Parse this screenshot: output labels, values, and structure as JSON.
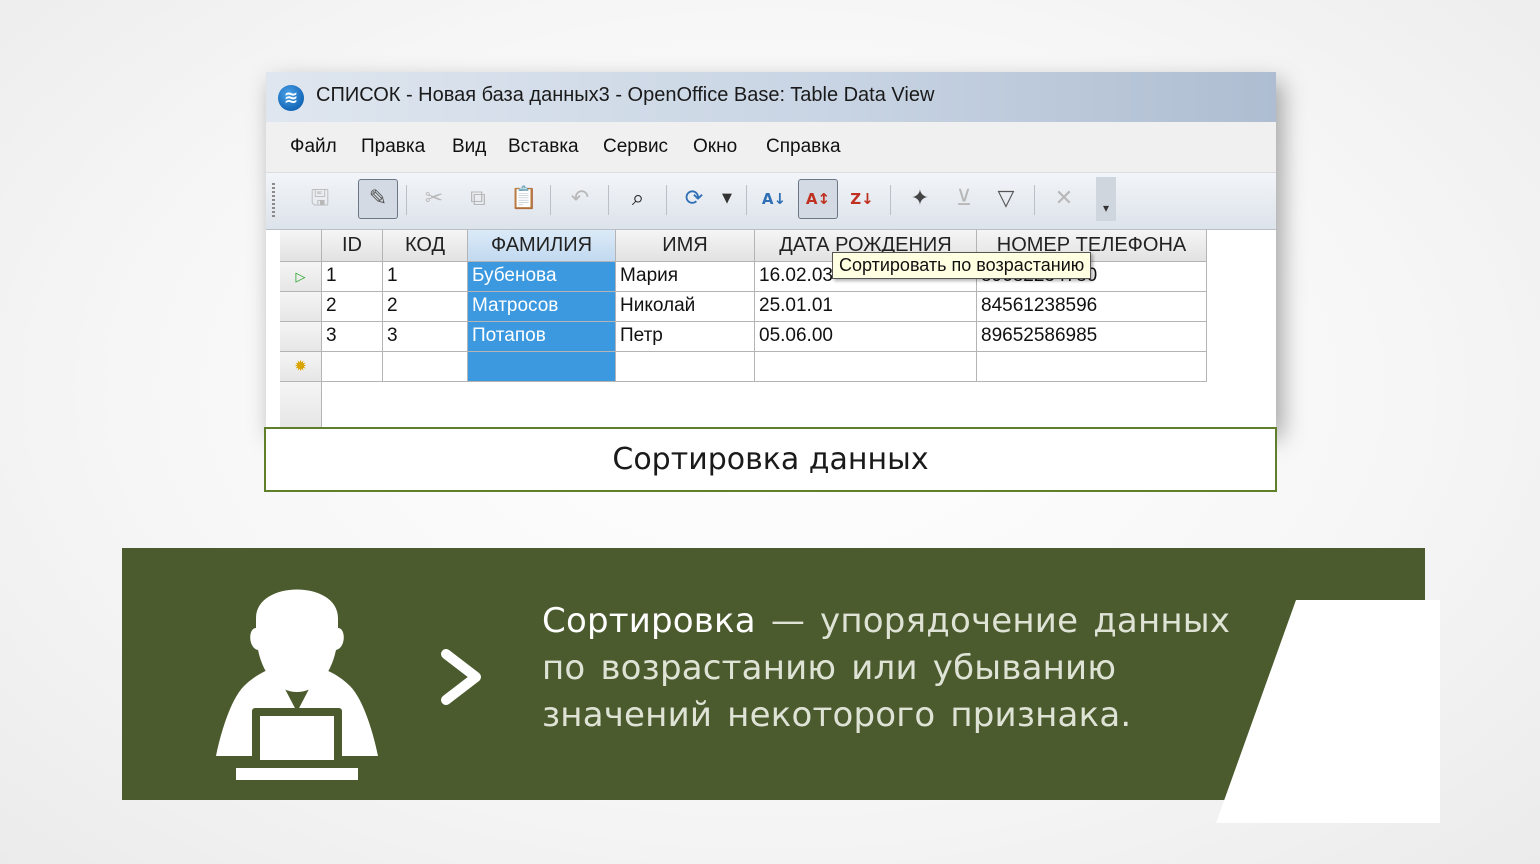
{
  "window": {
    "title": "СПИСОК - Новая база данных3 - OpenOffice Base: Table Data View",
    "logo_icon": "openoffice-logo-icon"
  },
  "menu": [
    "Файл",
    "Правка",
    "Вид",
    "Вставка",
    "Сервис",
    "Окно",
    "Справка"
  ],
  "toolbar": {
    "icons": [
      "save-icon",
      "edit-icon",
      "cut-icon",
      "copy-icon",
      "paste-icon",
      "undo-icon",
      "find-icon",
      "refresh-icon",
      "sort-ascending-icon",
      "sort-icon",
      "sort-descending-icon",
      "autofilter-icon",
      "standard-filter-icon",
      "filter-icon",
      "remove-filter-icon"
    ],
    "more_glyph": "▾"
  },
  "table": {
    "columns": [
      "ID",
      "КОД",
      "ФАМИЛИЯ",
      "ИМЯ",
      "ДАТА РОЖДЕНИЯ",
      "НОМЕР ТЕЛЕФОНА"
    ],
    "rows": [
      [
        "1",
        "1",
        "Бубенова",
        "Мария",
        "16.02.03",
        "89682234780"
      ],
      [
        "2",
        "2",
        "Матросов",
        "Николай",
        "25.01.01",
        "84561238596"
      ],
      [
        "3",
        "3",
        "Потапов",
        "Петр",
        "05.06.00",
        "89652586985"
      ]
    ],
    "selected_column": "ФАМИЛИЯ"
  },
  "tooltip": "Сортировать по возрастанию",
  "caption": "Сортировка данных",
  "definition": {
    "term": "Сортировка",
    "text": " — упорядочение данных по возрастанию или убыванию значений некоторого признака."
  },
  "colors": {
    "banner": "#4b5b2e",
    "caption_border": "#5f7f2a",
    "selection": "#3c99e0"
  }
}
